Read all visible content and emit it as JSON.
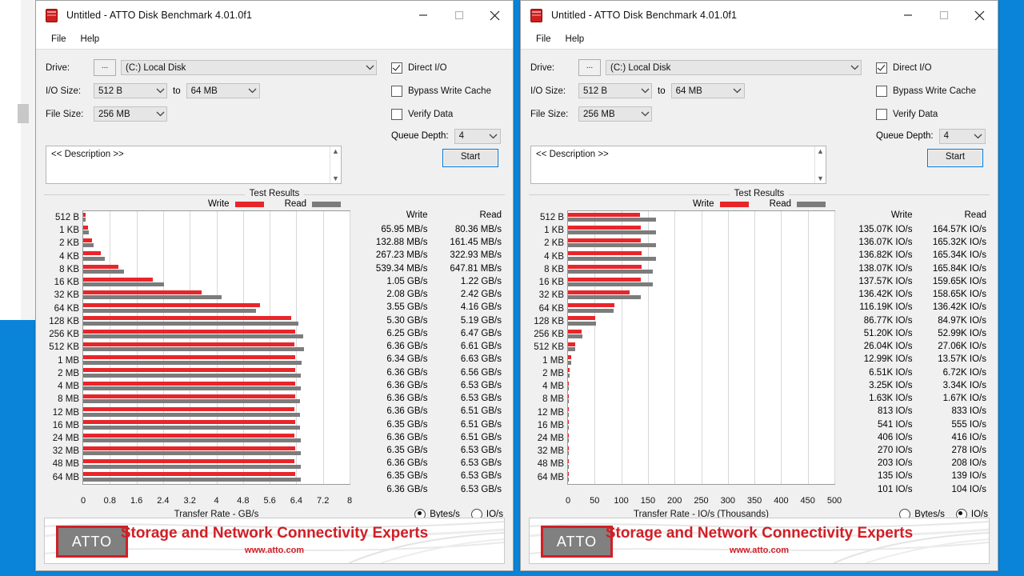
{
  "desktop": {
    "background": "#0a84d8"
  },
  "windows": [
    {
      "id": "left",
      "title": "Untitled - ATTO Disk Benchmark 4.01.0f1",
      "menu": [
        "File",
        "Help"
      ],
      "controls": {
        "minimize": "minimize-icon",
        "maximize": "maximize-icon",
        "close": "close-icon"
      },
      "settings": {
        "drive_label": "Drive:",
        "browse_button": "...",
        "drive_value": "(C:) Local Disk",
        "io_size_label": "I/O Size:",
        "io_size_from": "512 B",
        "io_size_to_label": "to",
        "io_size_to": "64 MB",
        "file_size_label": "File Size:",
        "file_size_value": "256 MB",
        "direct_io_label": "Direct I/O",
        "direct_io_checked": true,
        "bypass_label": "Bypass Write Cache",
        "bypass_checked": false,
        "verify_label": "Verify Data",
        "verify_checked": false,
        "queue_depth_label": "Queue Depth:",
        "queue_depth_value": "4"
      },
      "description_placeholder": "<< Description >>",
      "start_button": "Start",
      "results_title": "Test Results",
      "legend": {
        "write": "Write",
        "read": "Read"
      },
      "value_headers": {
        "write": "Write",
        "read": "Read"
      },
      "units_radio": {
        "bytes": "Bytes/s",
        "io": "IO/s",
        "selected": "Bytes/s"
      },
      "footer": {
        "logo": "ATTO",
        "tagline": "Storage and Network Connectivity Experts",
        "url": "www.atto.com"
      }
    },
    {
      "id": "right",
      "title": "Untitled - ATTO Disk Benchmark 4.01.0f1",
      "menu": [
        "File",
        "Help"
      ],
      "controls": {
        "minimize": "minimize-icon",
        "maximize": "maximize-icon",
        "close": "close-icon"
      },
      "settings": {
        "drive_label": "Drive:",
        "browse_button": "...",
        "drive_value": "(C:) Local Disk",
        "io_size_label": "I/O Size:",
        "io_size_from": "512 B",
        "io_size_to_label": "to",
        "io_size_to": "64 MB",
        "file_size_label": "File Size:",
        "file_size_value": "256 MB",
        "direct_io_label": "Direct I/O",
        "direct_io_checked": true,
        "bypass_label": "Bypass Write Cache",
        "bypass_checked": false,
        "verify_label": "Verify Data",
        "verify_checked": false,
        "queue_depth_label": "Queue Depth:",
        "queue_depth_value": "4"
      },
      "description_placeholder": "<< Description >>",
      "start_button": "Start",
      "results_title": "Test Results",
      "legend": {
        "write": "Write",
        "read": "Read"
      },
      "value_headers": {
        "write": "Write",
        "read": "Read"
      },
      "units_radio": {
        "bytes": "Bytes/s",
        "io": "IO/s",
        "selected": "IO/s"
      },
      "footer": {
        "logo": "ATTO",
        "tagline": "Storage and Network Connectivity Experts",
        "url": "www.atto.com"
      }
    }
  ],
  "chart_data": [
    {
      "type": "bar",
      "orientation": "horizontal",
      "title": "Test Results",
      "xlabel": "Transfer Rate - GB/s",
      "ylabel": "",
      "xlim": [
        0,
        8
      ],
      "xticks": [
        "0",
        "0.8",
        "1.6",
        "2.4",
        "3.2",
        "4",
        "4.8",
        "5.6",
        "6.4",
        "7.2",
        "8"
      ],
      "grid": true,
      "legend_position": "top",
      "categories": [
        "512 B",
        "1 KB",
        "2 KB",
        "4 KB",
        "8 KB",
        "16 KB",
        "32 KB",
        "64 KB",
        "128 KB",
        "256 KB",
        "512 KB",
        "1 MB",
        "2 MB",
        "4 MB",
        "8 MB",
        "12 MB",
        "16 MB",
        "24 MB",
        "32 MB",
        "48 MB",
        "64 MB"
      ],
      "series": [
        {
          "name": "Write",
          "color": "#e8262a",
          "values": [
            0.06595,
            0.13288,
            0.26723,
            0.53934,
            1.05,
            2.08,
            3.55,
            5.3,
            6.25,
            6.36,
            6.34,
            6.36,
            6.36,
            6.36,
            6.36,
            6.35,
            6.36,
            6.35,
            6.36,
            6.35,
            6.36
          ],
          "labels": [
            "65.95 MB/s",
            "132.88 MB/s",
            "267.23 MB/s",
            "539.34 MB/s",
            "1.05 GB/s",
            "2.08 GB/s",
            "3.55 GB/s",
            "5.30 GB/s",
            "6.25 GB/s",
            "6.36 GB/s",
            "6.34 GB/s",
            "6.36 GB/s",
            "6.36 GB/s",
            "6.36 GB/s",
            "6.36 GB/s",
            "6.35 GB/s",
            "6.36 GB/s",
            "6.35 GB/s",
            "6.36 GB/s",
            "6.35 GB/s",
            "6.36 GB/s"
          ]
        },
        {
          "name": "Read",
          "color": "#7c7c7c",
          "values": [
            0.08036,
            0.16145,
            0.32293,
            0.64781,
            1.22,
            2.42,
            4.16,
            5.19,
            6.47,
            6.61,
            6.63,
            6.56,
            6.53,
            6.53,
            6.51,
            6.51,
            6.51,
            6.53,
            6.53,
            6.53,
            6.53
          ],
          "labels": [
            "80.36 MB/s",
            "161.45 MB/s",
            "322.93 MB/s",
            "647.81 MB/s",
            "1.22 GB/s",
            "2.42 GB/s",
            "4.16 GB/s",
            "5.19 GB/s",
            "6.47 GB/s",
            "6.61 GB/s",
            "6.63 GB/s",
            "6.56 GB/s",
            "6.53 GB/s",
            "6.53 GB/s",
            "6.51 GB/s",
            "6.51 GB/s",
            "6.51 GB/s",
            "6.53 GB/s",
            "6.53 GB/s",
            "6.53 GB/s",
            "6.53 GB/s"
          ]
        }
      ]
    },
    {
      "type": "bar",
      "orientation": "horizontal",
      "title": "Test Results",
      "xlabel": "Transfer Rate - IO/s (Thousands)",
      "ylabel": "",
      "xlim": [
        0,
        500
      ],
      "xticks": [
        "0",
        "50",
        "100",
        "150",
        "200",
        "250",
        "300",
        "350",
        "400",
        "450",
        "500"
      ],
      "grid": true,
      "legend_position": "top",
      "categories": [
        "512 B",
        "1 KB",
        "2 KB",
        "4 KB",
        "8 KB",
        "16 KB",
        "32 KB",
        "64 KB",
        "128 KB",
        "256 KB",
        "512 KB",
        "1 MB",
        "2 MB",
        "4 MB",
        "8 MB",
        "12 MB",
        "16 MB",
        "24 MB",
        "32 MB",
        "48 MB",
        "64 MB"
      ],
      "series": [
        {
          "name": "Write",
          "color": "#e8262a",
          "values": [
            135.07,
            136.07,
            136.82,
            138.07,
            137.57,
            136.42,
            116.19,
            86.77,
            51.2,
            26.04,
            12.99,
            6.51,
            3.25,
            1.63,
            0.813,
            0.541,
            0.406,
            0.27,
            0.203,
            0.135,
            0.101
          ],
          "labels": [
            "135.07K IO/s",
            "136.07K IO/s",
            "136.82K IO/s",
            "138.07K IO/s",
            "137.57K IO/s",
            "136.42K IO/s",
            "116.19K IO/s",
            "86.77K IO/s",
            "51.20K IO/s",
            "26.04K IO/s",
            "12.99K IO/s",
            "6.51K IO/s",
            "3.25K IO/s",
            "1.63K IO/s",
            "813 IO/s",
            "541 IO/s",
            "406 IO/s",
            "270 IO/s",
            "203 IO/s",
            "135 IO/s",
            "101 IO/s"
          ]
        },
        {
          "name": "Read",
          "color": "#7c7c7c",
          "values": [
            164.57,
            165.32,
            165.34,
            165.84,
            159.65,
            158.65,
            136.42,
            84.97,
            52.99,
            27.06,
            13.57,
            6.72,
            3.34,
            1.67,
            0.833,
            0.555,
            0.416,
            0.278,
            0.208,
            0.139,
            0.104
          ],
          "labels": [
            "164.57K IO/s",
            "165.32K IO/s",
            "165.34K IO/s",
            "165.84K IO/s",
            "159.65K IO/s",
            "158.65K IO/s",
            "136.42K IO/s",
            "84.97K IO/s",
            "52.99K IO/s",
            "27.06K IO/s",
            "13.57K IO/s",
            "6.72K IO/s",
            "3.34K IO/s",
            "1.67K IO/s",
            "833 IO/s",
            "555 IO/s",
            "416 IO/s",
            "278 IO/s",
            "208 IO/s",
            "139 IO/s",
            "104 IO/s"
          ]
        }
      ]
    }
  ]
}
